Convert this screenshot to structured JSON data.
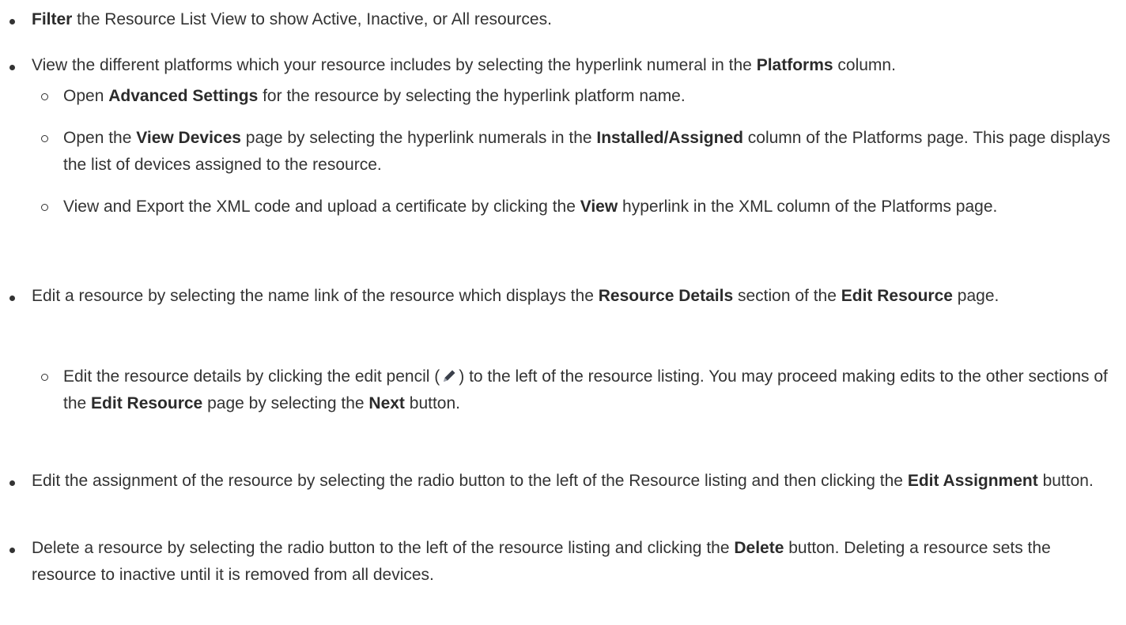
{
  "items": [
    {
      "parts": [
        {
          "b": true,
          "t": "Filter"
        },
        {
          "t": " the Resource List View to show Active, Inactive, or All resources."
        }
      ]
    },
    {
      "parts": [
        {
          "t": "View the different platforms which your resource includes by selecting the hyperlink numeral in the "
        },
        {
          "b": true,
          "t": "Platforms"
        },
        {
          "t": " column."
        }
      ],
      "sub": [
        {
          "parts": [
            {
              "t": "Open "
            },
            {
              "b": true,
              "t": "Advanced Settings"
            },
            {
              "t": " for the resource by selecting the hyperlink platform name."
            }
          ]
        },
        {
          "parts": [
            {
              "t": "Open the "
            },
            {
              "b": true,
              "t": "View Devices"
            },
            {
              "t": " page by selecting the hyperlink numerals in the "
            },
            {
              "b": true,
              "t": "Installed/Assigned"
            },
            {
              "t": " column of the Platforms page. This page displays the list of devices assigned to the resource."
            }
          ]
        },
        {
          "parts": [
            {
              "t": "View and Export the XML code and upload a certificate by clicking the "
            },
            {
              "b": true,
              "t": "View"
            },
            {
              "t": " hyperlink in the XML column of the Platforms page."
            }
          ]
        }
      ]
    },
    {
      "parts": [
        {
          "t": "Edit a resource by selecting the name link of the resource which displays the "
        },
        {
          "b": true,
          "t": "Resource Details"
        },
        {
          "t": " section of the "
        },
        {
          "b": true,
          "t": "Edit Resource"
        },
        {
          "t": " page."
        }
      ],
      "sub": [
        {
          "parts": [
            {
              "t": "Edit the resource details by clicking the edit pencil ("
            },
            {
              "icon": "pencil-icon"
            },
            {
              "t": ") to the left of the resource listing. You may proceed making edits to the other sections of the "
            },
            {
              "b": true,
              "t": "Edit Resource"
            },
            {
              "t": " page by selecting the "
            },
            {
              "b": true,
              "t": "Next"
            },
            {
              "t": " button."
            }
          ]
        }
      ]
    },
    {
      "parts": [
        {
          "t": "Edit the assignment of the resource by selecting the radio button to the left of the Resource listing and then clicking the "
        },
        {
          "b": true,
          "t": "Edit Assignment"
        },
        {
          "t": " button."
        }
      ]
    },
    {
      "parts": [
        {
          "t": "Delete a resource by selecting the radio button to the left of the resource listing and clicking the "
        },
        {
          "b": true,
          "t": "Delete"
        },
        {
          "t": " button. Deleting a resource sets the resource to inactive until it is removed from all devices."
        }
      ]
    }
  ]
}
